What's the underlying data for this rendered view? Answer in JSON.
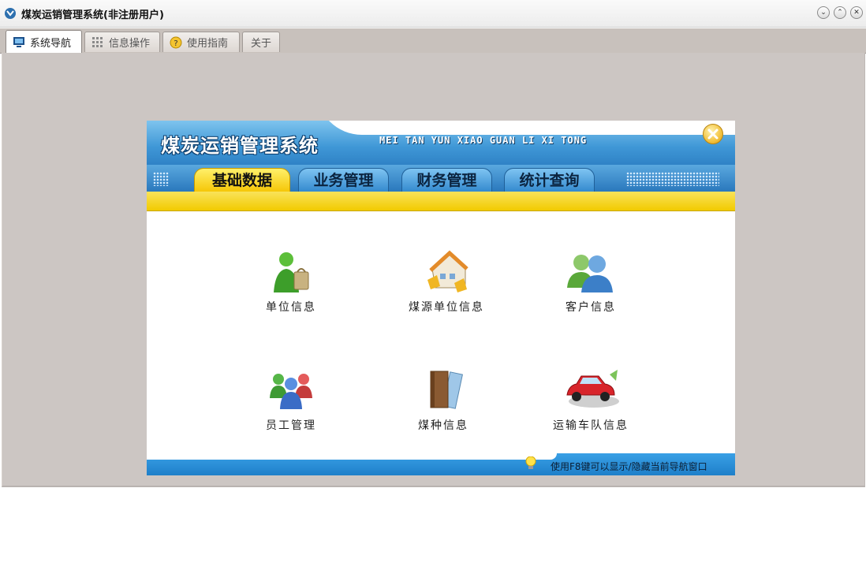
{
  "window": {
    "title": "煤炭运销管理系统(非注册用户)",
    "controls": [
      "⌄",
      "⌃",
      "✕"
    ]
  },
  "tabs": [
    {
      "label": "系统导航",
      "icon": "monitor-icon",
      "active": true
    },
    {
      "label": "信息操作",
      "icon": "grid-icon",
      "active": false
    },
    {
      "label": "使用指南",
      "icon": "help-icon",
      "active": false
    },
    {
      "label": "关于",
      "icon": "",
      "active": false
    }
  ],
  "panel": {
    "logo": "煤炭运销管理系统",
    "pinyin": "MEI TAN YUN XIAO GUAN LI XI TONG",
    "nav_tabs": [
      {
        "label": "基础数据",
        "active": true
      },
      {
        "label": "业务管理",
        "active": false
      },
      {
        "label": "财务管理",
        "active": false
      },
      {
        "label": "统计查询",
        "active": false
      }
    ],
    "items": [
      {
        "label": "单位信息",
        "icon": "unit-user-icon"
      },
      {
        "label": "煤源单位信息",
        "icon": "building-icon"
      },
      {
        "label": "客户信息",
        "icon": "customers-icon"
      },
      {
        "label": "员工管理",
        "icon": "staff-icon"
      },
      {
        "label": "煤种信息",
        "icon": "books-icon"
      },
      {
        "label": "运输车队信息",
        "icon": "car-icon"
      }
    ],
    "tip": "使用F8键可以显示/隐藏当前导航窗口"
  },
  "colors": {
    "accent_yellow": "#f5c400",
    "accent_blue": "#2f86cc",
    "workspace": "#ccc6c3"
  }
}
